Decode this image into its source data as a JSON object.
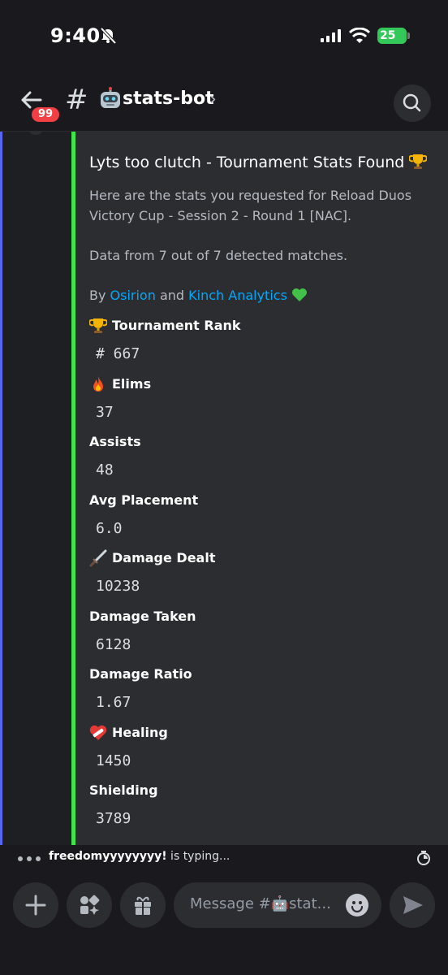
{
  "status_bar": {
    "time": "9:40",
    "battery": "25"
  },
  "header": {
    "badge": "99",
    "channel_name": "stats-bot",
    "chevron": "›"
  },
  "embed": {
    "accent_color": "#3ee64b",
    "title": "Lyts too clutch - Tournament Stats Found",
    "description": "Here are the stats you requested for Reload Duos Victory Cup - Session 2 - Round 1 [NAC].",
    "data_line": "Data from 7 out of 7 detected matches.",
    "by_prefix": "By ",
    "author1": "Osirion",
    "and_text": " and ",
    "author2": "Kinch Analytics",
    "fields": [
      {
        "icon": "trophy-icon",
        "name": "Tournament Rank",
        "value": "# 667"
      },
      {
        "icon": "fire-icon",
        "name": "Elims",
        "value": "37"
      },
      {
        "icon": "",
        "name": "Assists",
        "value": "48"
      },
      {
        "icon": "",
        "name": "Avg Placement",
        "value": "6.0"
      },
      {
        "icon": "dagger-icon",
        "name": "Damage Dealt",
        "value": "10238"
      },
      {
        "icon": "",
        "name": "Damage Taken",
        "value": "6128"
      },
      {
        "icon": "",
        "name": "Damage Ratio",
        "value": "1.67"
      },
      {
        "icon": "mending-heart-icon",
        "name": "Healing",
        "value": "1450"
      },
      {
        "icon": "",
        "name": "Shielding",
        "value": "3789"
      }
    ]
  },
  "typing": {
    "user": "freedomyyyyyyyy!",
    "suffix": " is typing..."
  },
  "composer": {
    "placeholder": "Message #🤖stat..."
  }
}
